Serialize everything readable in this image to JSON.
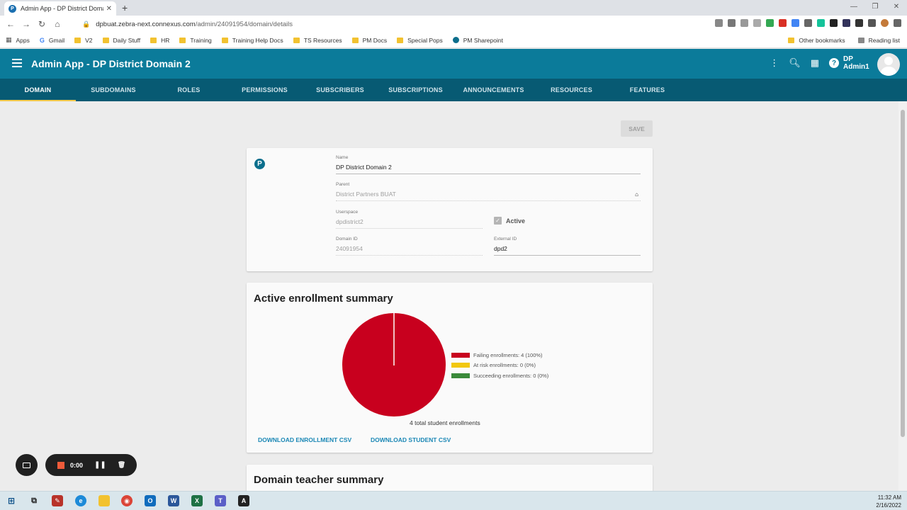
{
  "browser": {
    "tab_title": "Admin App - DP District Domain",
    "tab_favicon": "P",
    "url_host": "dpbuat.zebra-next.connexus.com",
    "url_path": "/admin/24091954/domain/details",
    "bookmarks": [
      "Apps",
      "Gmail",
      "V2",
      "Daily Stuff",
      "HR",
      "Training",
      "Training Help Docs",
      "TS Resources",
      "PM Docs",
      "Special Pops",
      "PM Sharepoint"
    ],
    "other_bookmarks": "Other bookmarks",
    "reading_list": "Reading list"
  },
  "app": {
    "title": "Admin App - DP District Domain 2",
    "user_line1": "DP",
    "user_line2": "Admin1",
    "accent_color": "#0b7b9a"
  },
  "tabs": [
    "DOMAIN",
    "SUBDOMAINS",
    "ROLES",
    "PERMISSIONS",
    "SUBSCRIBERS",
    "SUBSCRIPTIONS",
    "ANNOUNCEMENTS",
    "RESOURCES",
    "FEATURES"
  ],
  "save_label": "SAVE",
  "domain": {
    "logo_letter": "P",
    "name_label": "Name",
    "name_value": "DP District Domain 2",
    "parent_label": "Parent",
    "parent_value": "District Partners BUAT",
    "userspace_label": "Userspace",
    "userspace_value": "dpdistrict2",
    "active_label": "Active",
    "domain_id_label": "Domain ID",
    "domain_id_value": "24091954",
    "external_id_label": "External ID",
    "external_id_value": "dpd2"
  },
  "enrollment": {
    "title": "Active enrollment summary",
    "total_text": "4 total student enrollments",
    "download_enrollment": "DOWNLOAD ENROLLMENT CSV",
    "download_student": "DOWNLOAD STUDENT CSV"
  },
  "chart_data": {
    "type": "pie",
    "categories": [
      "Failing enrollments",
      "At risk enrollments",
      "Succeeding enrollments"
    ],
    "values": [
      4,
      0,
      0
    ],
    "legend_labels": [
      "Failing enrollments: 4 (100%)",
      "At risk enrollments: 0 (0%)",
      "Succeeding enrollments: 0 (0%)"
    ],
    "colors": [
      "#c8001e",
      "#f2c80f",
      "#3a8a3a"
    ],
    "legend_position": "right"
  },
  "teacher": {
    "title": "Domain teacher summary"
  },
  "recorder": {
    "time": "0:00"
  },
  "clock": {
    "time": "11:32 AM",
    "date": "2/16/2022"
  }
}
